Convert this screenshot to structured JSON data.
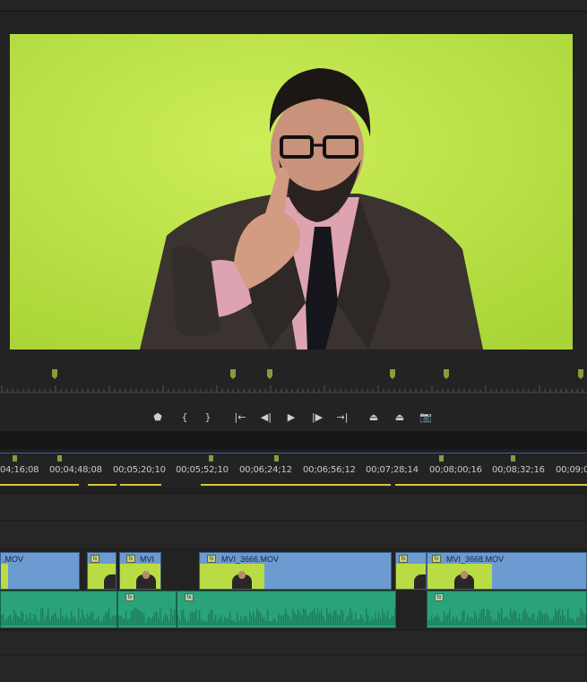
{
  "program_monitor": {
    "subject": "man in suit pointing at camera against green screen",
    "background_color": "#bde34a"
  },
  "transport": {
    "buttons": [
      {
        "name": "add-marker",
        "glyph": "⬟"
      },
      {
        "name": "mark-in",
        "glyph": "{"
      },
      {
        "name": "mark-out",
        "glyph": "}"
      },
      {
        "name": "go-to-in",
        "glyph": "|←"
      },
      {
        "name": "step-back",
        "glyph": "◀|"
      },
      {
        "name": "play",
        "glyph": "▶"
      },
      {
        "name": "step-forward",
        "glyph": "|▶"
      },
      {
        "name": "go-to-out",
        "glyph": "→|"
      },
      {
        "name": "lift",
        "glyph": "⏏"
      },
      {
        "name": "extract",
        "glyph": "⏏"
      },
      {
        "name": "export-frame",
        "glyph": "📷"
      }
    ]
  },
  "timeline": {
    "timecodes": [
      "04;16;08",
      "00;04;48;08",
      "00;05;20;10",
      "00;05;52;10",
      "00;06;24;12",
      "00;06;56;12",
      "00;07;28;14",
      "00;08;00;16",
      "00;08;32;16",
      "00;09;0"
    ],
    "video_clips": [
      {
        "label": ".MOV",
        "fx": false
      },
      {
        "label": "",
        "fx": true
      },
      {
        "label": "MVI",
        "fx": true
      },
      {
        "label": "MVI_3666.MOV",
        "fx": true
      },
      {
        "label": "",
        "fx": true
      },
      {
        "label": "MVI_3668.MOV",
        "fx": true
      }
    ],
    "audio_clip_fx": [
      "fx",
      "fx",
      "fx"
    ],
    "accent_color": "#6b9bd1",
    "audio_color": "#2aa37b"
  }
}
